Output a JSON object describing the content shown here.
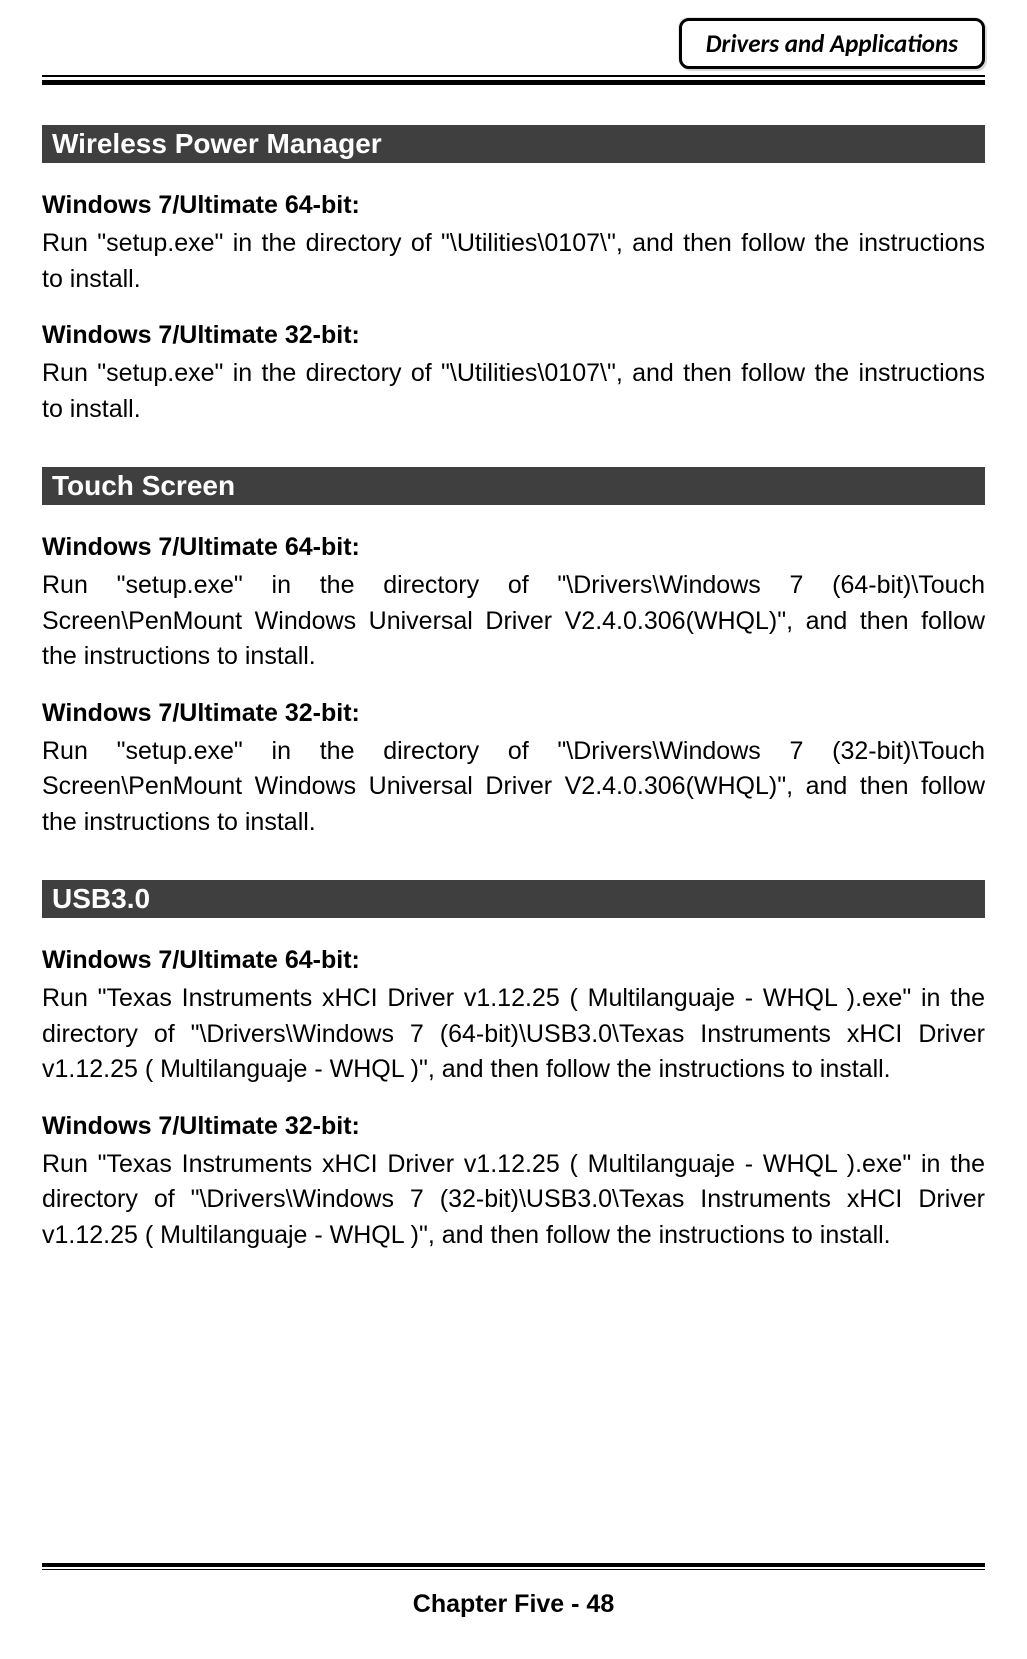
{
  "header": {
    "badge": "Drivers and Applications"
  },
  "sections": [
    {
      "title": "Wireless Power Manager",
      "items": [
        {
          "heading": "Windows 7/Ultimate 64-bit:",
          "body": "Run \"setup.exe\" in the directory of \"\\Utilities\\0107\\\", and then follow the instructions to install."
        },
        {
          "heading": "Windows 7/Ultimate 32-bit:",
          "body": "Run \"setup.exe\" in the directory of \"\\Utilities\\0107\\\", and then follow the instructions to install."
        }
      ]
    },
    {
      "title": "Touch Screen",
      "items": [
        {
          "heading": "Windows 7/Ultimate 64-bit:",
          "body": "Run \"setup.exe\" in the directory of \"\\Drivers\\Windows 7 (64-bit)\\Touch Screen\\PenMount Windows Universal Driver V2.4.0.306(WHQL)\", and then follow the instructions to install."
        },
        {
          "heading": "Windows 7/Ultimate 32-bit:",
          "body": "Run \"setup.exe\" in the directory of \"\\Drivers\\Windows 7 (32-bit)\\Touch Screen\\PenMount Windows Universal Driver V2.4.0.306(WHQL)\", and then follow the instructions to install."
        }
      ]
    },
    {
      "title": "USB3.0",
      "items": [
        {
          "heading": "Windows 7/Ultimate 64-bit:",
          "body": "Run \"Texas Instruments xHCI Driver v1.12.25 ( Multilanguaje - WHQL ).exe\" in the directory of \"\\Drivers\\Windows 7 (64-bit)\\USB3.0\\Texas Instruments xHCI Driver v1.12.25 ( Multilanguaje - WHQL )\", and then follow the instructions to install."
        },
        {
          "heading": "Windows 7/Ultimate 32-bit:",
          "body": "Run \"Texas Instruments xHCI Driver v1.12.25 ( Multilanguaje - WHQL ).exe\" in the directory of \"\\Drivers\\Windows 7 (32-bit)\\USB3.0\\Texas Instruments xHCI Driver v1.12.25 ( Multilanguaje - WHQL )\", and then follow the instructions to install."
        }
      ]
    }
  ],
  "footer": {
    "text": "Chapter Five - 48"
  }
}
